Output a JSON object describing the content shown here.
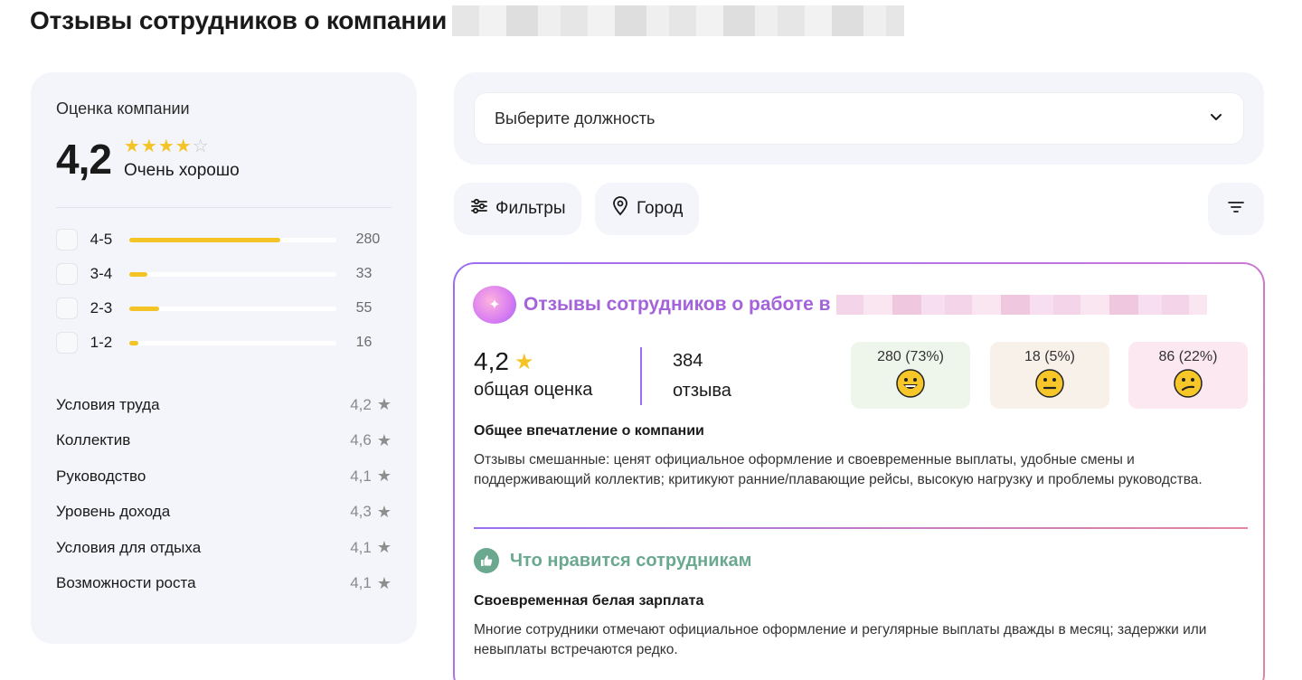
{
  "page": {
    "title": "Отзывы сотрудников о компании"
  },
  "summary": {
    "label": "Оценка компании",
    "score": "4,2",
    "stars_filled": 4,
    "stars_total": 5,
    "score_word": "Очень хорошо",
    "distribution": [
      {
        "label": "4-5",
        "count": "280",
        "fraction": 0.73
      },
      {
        "label": "3-4",
        "count": "33",
        "fraction": 0.086
      },
      {
        "label": "2-3",
        "count": "55",
        "fraction": 0.143
      },
      {
        "label": "1-2",
        "count": "16",
        "fraction": 0.042
      }
    ],
    "categories": [
      {
        "name": "Условия труда",
        "value": "4,2"
      },
      {
        "name": "Коллектив",
        "value": "4,6"
      },
      {
        "name": "Руководство",
        "value": "4,1"
      },
      {
        "name": "Уровень дохода",
        "value": "4,3"
      },
      {
        "name": "Условия для отдыха",
        "value": "4,1"
      },
      {
        "name": "Возможности роста",
        "value": "4,1"
      }
    ]
  },
  "position_select": {
    "placeholder": "Выберите должность"
  },
  "filters": {
    "filters_label": "Фильтры",
    "city_label": "Город"
  },
  "review": {
    "title": "Отзывы сотрудников о работе в",
    "overall_score": "4,2",
    "overall_label": "общая оценка",
    "count": "384",
    "count_label": "отзыва",
    "moods": [
      {
        "text": "280 (73%)",
        "kind": "positive",
        "bg": "#eef6ec"
      },
      {
        "text": "18 (5%)",
        "kind": "neutral",
        "bg": "#f8f1ea"
      },
      {
        "text": "86 (22%)",
        "kind": "negative",
        "bg": "#fbe8f0"
      }
    ],
    "impression_title": "Общее впечатление о компании",
    "impression_text": "Отзывы смешанные: ценят официальное оформление и своевременные выплаты, удобные смены и поддерживающий коллектив; критикуют ранние/плавающие рейсы, высокую нагрузку и проблемы руководства.",
    "likes_title": "Что нравится сотрудникам",
    "like_item_title": "Своевременная белая зарплата",
    "like_item_text": "Многие сотрудники отмечают официальное оформление и регулярные выплаты дважды в месяц; задержки или невыплаты встречаются редко."
  },
  "colors": {
    "accent_yellow": "#f4c325",
    "accent_purple": "#a463da",
    "accent_green": "#6aa98f",
    "card_bg": "#f3f5fa"
  }
}
